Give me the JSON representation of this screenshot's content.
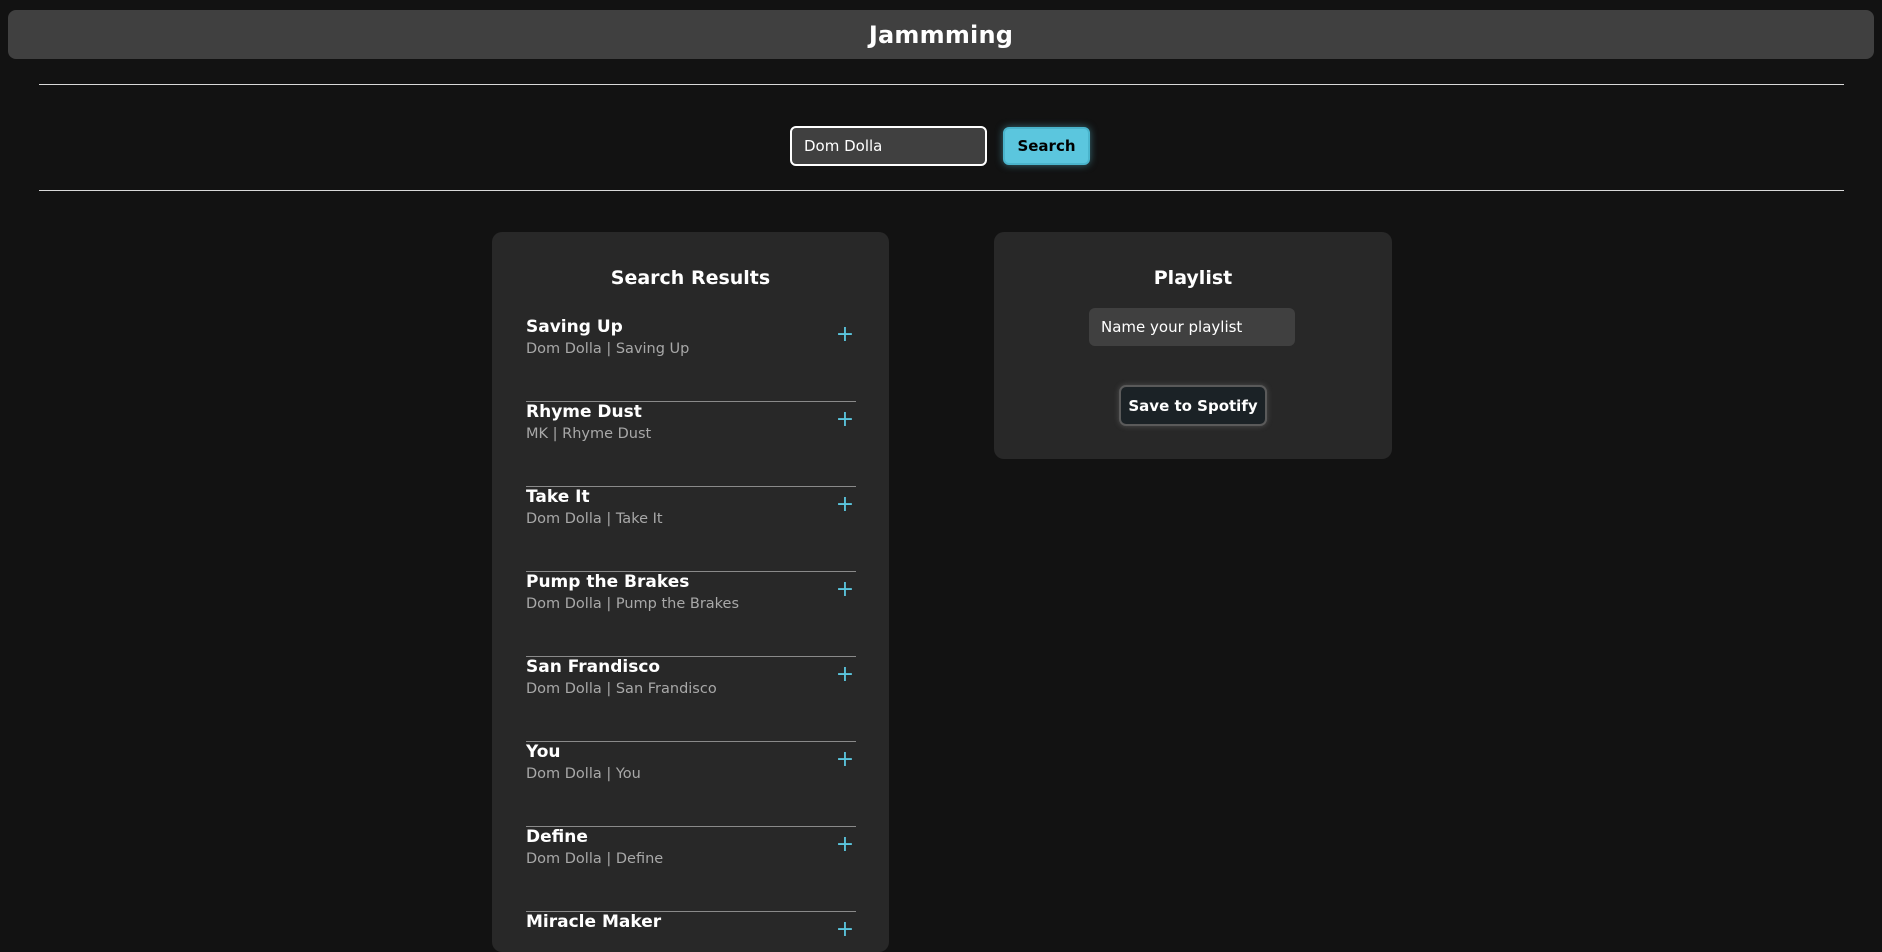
{
  "header": {
    "title": "Jammming"
  },
  "search": {
    "value": "Dom Dolla",
    "button_label": "Search"
  },
  "results": {
    "title": "Search Results",
    "add_symbol": "+",
    "tracks": [
      {
        "name": "Saving Up",
        "meta": "Dom Dolla | Saving Up"
      },
      {
        "name": "Rhyme Dust",
        "meta": "MK | Rhyme Dust"
      },
      {
        "name": "Take It",
        "meta": "Dom Dolla | Take It"
      },
      {
        "name": "Pump the Brakes",
        "meta": "Dom Dolla | Pump the Brakes"
      },
      {
        "name": "San Frandisco",
        "meta": "Dom Dolla | San Frandisco"
      },
      {
        "name": "You",
        "meta": "Dom Dolla | You"
      },
      {
        "name": "Define",
        "meta": "Dom Dolla | Define"
      },
      {
        "name": "Miracle Maker",
        "meta": ""
      }
    ]
  },
  "playlist": {
    "title": "Playlist",
    "name_placeholder": "Name your playlist",
    "save_label": "Save to Spotify"
  },
  "colors": {
    "background": "#121212",
    "panel": "#282828",
    "accent": "#5bc6de"
  }
}
